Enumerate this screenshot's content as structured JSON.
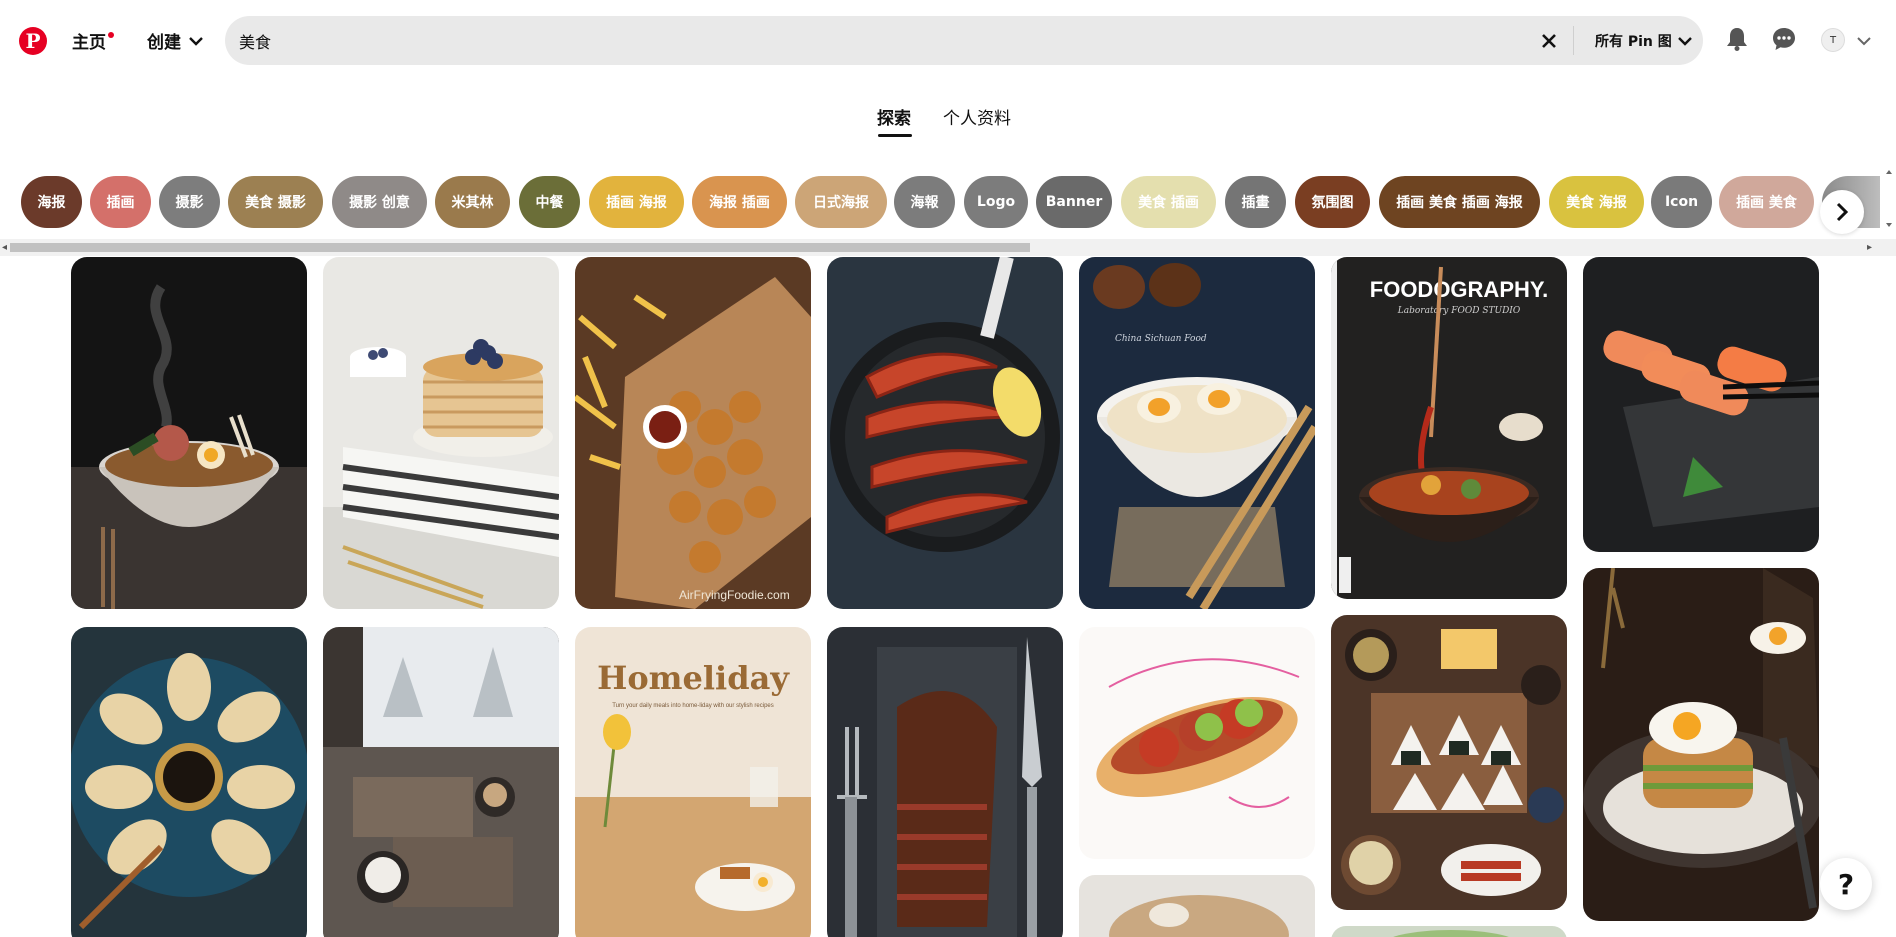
{
  "header": {
    "logo_letter": "P",
    "home_label": "主页",
    "create_label": "创建",
    "search_value": "美食",
    "search_scope": "所有 Pin 图",
    "avatar_initial": "T"
  },
  "tabs": [
    {
      "label": "探索",
      "active": true
    },
    {
      "label": "个人资料",
      "active": false
    }
  ],
  "chips": [
    {
      "label": "海报",
      "color": "#6b3a2a"
    },
    {
      "label": "插画",
      "color": "#d4706a"
    },
    {
      "label": "摄影",
      "color": "#7d7d7d"
    },
    {
      "label": "美食 摄影",
      "color": "#9c8052"
    },
    {
      "label": "摄影 创意",
      "color": "#8f8a88"
    },
    {
      "label": "米其林",
      "color": "#9a7a4c"
    },
    {
      "label": "中餐",
      "color": "#6b6e38"
    },
    {
      "label": "插画 海报",
      "color": "#e2b33d"
    },
    {
      "label": "海报 插画",
      "color": "#d9944f"
    },
    {
      "label": "日式海报",
      "color": "#cca577"
    },
    {
      "label": "海報",
      "color": "#7c7c7c"
    },
    {
      "label": "Logo",
      "color": "#7c7c7c"
    },
    {
      "label": "Banner",
      "color": "#6a6a6a"
    },
    {
      "label": "美食 插画",
      "color": "#e4dfae"
    },
    {
      "label": "插畫",
      "color": "#757575"
    },
    {
      "label": "氛围图",
      "color": "#7a3e22"
    },
    {
      "label": "插画 美食 插画 海报",
      "color": "#6e4421"
    },
    {
      "label": "美食 海报",
      "color": "#d9c23f"
    },
    {
      "label": "Icon",
      "color": "#7a7a7a"
    },
    {
      "label": "插画 美食",
      "color": "#d0a89b"
    }
  ],
  "pins": [
    {
      "name": "pin-ramen-bowl",
      "desc": "ramen bowl"
    },
    {
      "name": "pin-pancakes",
      "desc": "pancakes with blueberries"
    },
    {
      "name": "pin-fried-chicken",
      "desc": "fried chicken board",
      "caption": "AirFryingFoodie.com"
    },
    {
      "name": "pin-shrimp-pan",
      "desc": "shrimp in pan"
    },
    {
      "name": "pin-noodle-egg",
      "desc": "noodles with egg",
      "caption": "China Sichuan Food"
    },
    {
      "name": "pin-foodography",
      "desc": "foodography poster",
      "title": "FOODOGRAPHY.",
      "subtitle": "Laboratory  FOOD STUDIO"
    },
    {
      "name": "pin-sushi",
      "desc": "salmon sushi"
    },
    {
      "name": "pin-dumplings",
      "desc": "dumplings plate"
    },
    {
      "name": "pin-table-snow",
      "desc": "table by snowy window"
    },
    {
      "name": "pin-homeliday",
      "desc": "homeliday poster",
      "title": "Homeliday",
      "subtitle": "Turn your daily meals into home-liday with our stylish recipes"
    },
    {
      "name": "pin-steak",
      "desc": "steak on slate"
    },
    {
      "name": "pin-hotdog",
      "desc": "hotdog illustration"
    },
    {
      "name": "pin-japanese-set",
      "desc": "onigiri set meal"
    },
    {
      "name": "pin-sandwich-egg",
      "desc": "sandwich with egg"
    },
    {
      "name": "pin-partial-1",
      "desc": "partial pin"
    },
    {
      "name": "pin-partial-2",
      "desc": "partial pin"
    }
  ],
  "help_label": "?"
}
